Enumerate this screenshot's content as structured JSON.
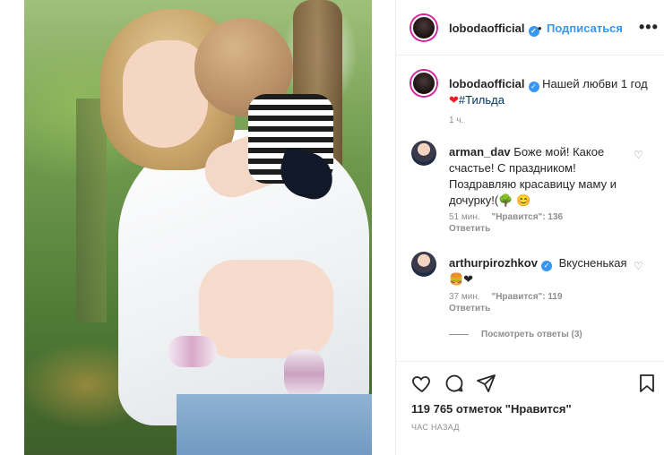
{
  "post": {
    "author": "lobodaofficial",
    "follow_label": "Подписаться",
    "more_label": "•••",
    "separator": "•",
    "caption_text": "Нашей любви 1 год",
    "caption_heart": "❤",
    "caption_tag": "#Тильда",
    "caption_time": "1 ч."
  },
  "comments": [
    {
      "username": "arman_dav",
      "text": "Боже мой! Какое счастье! С праздником! Поздравляю красавицу маму и дочурку!(🌳 😊",
      "time": "51 мин.",
      "likes": "\"Нравится\": 136",
      "reply": "Ответить"
    },
    {
      "username": "arthurpirozhkov",
      "text": "Вкусненькая",
      "emoji": "🍔❤",
      "time": "37 мин.",
      "likes": "\"Нравится\": 119",
      "reply": "Ответить"
    }
  ],
  "view_replies": "Посмотреть ответы (3)",
  "actions": {
    "likes_count": "119 765 отметок \"Нравится\"",
    "time_ago": "ЧАС НАЗАД"
  },
  "icons": {
    "like": "heart-icon",
    "comment": "comment-icon",
    "share": "share-icon",
    "save": "bookmark-icon"
  },
  "colors": {
    "accent": "#3897f0",
    "text": "#262626",
    "muted": "#8e8e8e",
    "heart": "#ed1c24"
  }
}
